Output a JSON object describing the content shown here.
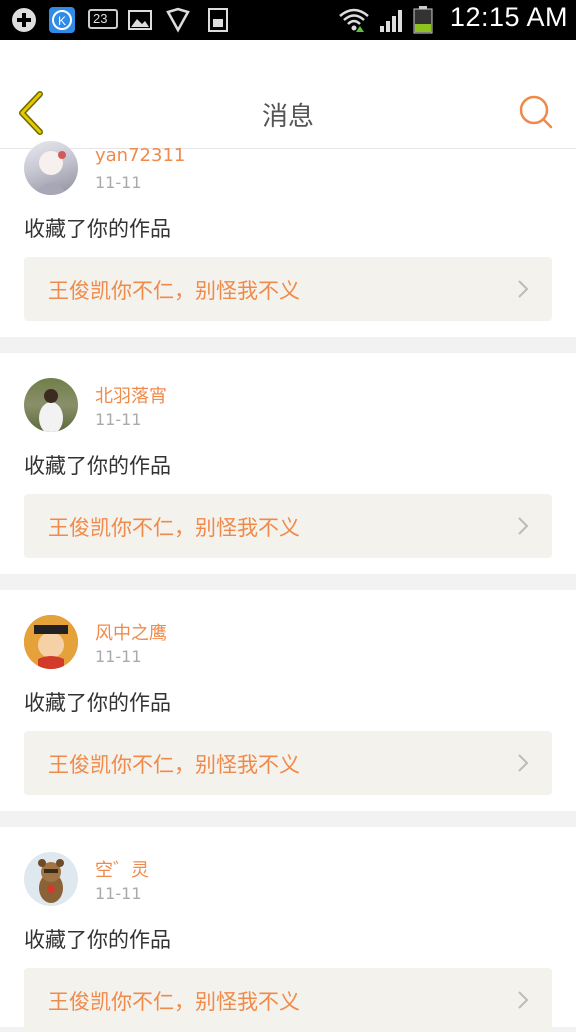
{
  "status_bar": {
    "time": "12:15 AM",
    "notification_count": "23",
    "icons": [
      "add-circle-icon",
      "kk-app-icon",
      "calendar-icon",
      "image-icon",
      "shield-icon",
      "sim-icon",
      "wifi-icon",
      "signal-icon",
      "battery-icon"
    ]
  },
  "header": {
    "title": "消息",
    "back_icon": "chevron-left-icon",
    "search_icon": "search-icon"
  },
  "colors": {
    "accent": "#f08a4b",
    "back": "#e8b400",
    "card_bg": "#ffffff",
    "link_bg": "#f3f2ec",
    "divider": "#f2f2f2"
  },
  "messages": [
    {
      "username": "yan72311",
      "date": "11-11",
      "action": "收藏了你的作品",
      "work_title": "王俊凯你不仁，别怪我不义"
    },
    {
      "username": "北羽落宵",
      "date": "11-11",
      "action": "收藏了你的作品",
      "work_title": "王俊凯你不仁，别怪我不义"
    },
    {
      "username": "风中之鹰",
      "date": "11-11",
      "action": "收藏了你的作品",
      "work_title": "王俊凯你不仁，别怪我不义"
    },
    {
      "username": "空゛灵",
      "date": "11-11",
      "action": "收藏了你的作品",
      "work_title": "王俊凯你不仁，别怪我不义"
    }
  ]
}
